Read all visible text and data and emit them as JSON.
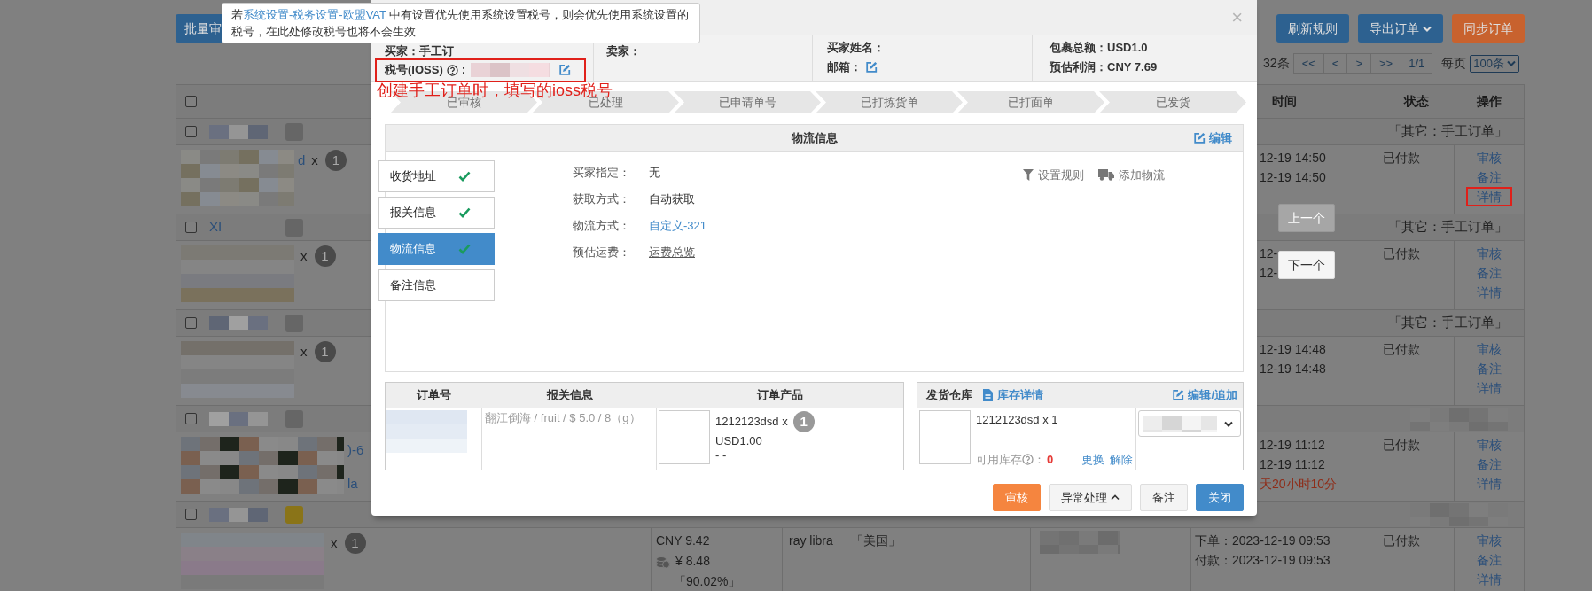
{
  "toolbar": {
    "batch_button": "批量审",
    "buttons": [
      {
        "label": "刷新规则",
        "kind": "primary"
      },
      {
        "label": "导出订单",
        "kind": "dropdown"
      },
      {
        "label": "同步订单",
        "kind": "accent"
      }
    ]
  },
  "pagination": {
    "total": "32条",
    "buttons": [
      "<<",
      "<",
      ">",
      ">>"
    ],
    "page": "1/1",
    "per_page_label": "每页",
    "per_page": "100条"
  },
  "table": {
    "header_checked": false,
    "columns": [
      "时间",
      "状态",
      "操作"
    ],
    "groups": [
      {
        "checked": false,
        "color": "#666666",
        "source": "「其它：手工订单」",
        "product_name": "d",
        "quantity_x": "x",
        "quantity": "1",
        "times_cut": true,
        "times": [
          "12-19 14:50",
          "12-19 14:50"
        ],
        "status": "已付款",
        "actions": [
          {
            "label": "审核",
            "highlighted": false
          },
          {
            "label": "备注",
            "highlighted": false
          },
          {
            "label": "详情",
            "highlighted": true
          }
        ]
      },
      {
        "checked": false,
        "order_link": "XI",
        "color": "#666666",
        "source": "「其它：手工订单」",
        "quantity_x": "x",
        "quantity": "1",
        "times_cut": true,
        "times": [
          "12-",
          "12-"
        ],
        "status": "已付款",
        "actions": [
          {
            "label": "审核",
            "highlighted": false
          },
          {
            "label": "备注",
            "highlighted": false
          },
          {
            "label": "详情",
            "highlighted": false
          }
        ]
      },
      {
        "checked": false,
        "color": "#666666",
        "source": "「其它：手工订单」",
        "quantity_x": "x",
        "quantity": "1",
        "times_cut": true,
        "times": [
          "12-19 14:48",
          "12-19 14:48"
        ],
        "status": "已付款",
        "actions": [
          {
            "label": "审核",
            "highlighted": false
          },
          {
            "label": "备注",
            "highlighted": false
          },
          {
            "label": "详情",
            "highlighted": false
          }
        ]
      },
      {
        "checked": false,
        "color": "#666666",
        "product_lines": [
          ")-6",
          "la"
        ],
        "times_cut": true,
        "times": [
          "12-19 11:12",
          "12-19 11:12"
        ],
        "countdown": "天20小时10分",
        "status": "已付款",
        "actions": [
          {
            "label": "审核",
            "highlighted": false
          },
          {
            "label": "备注",
            "highlighted": false
          },
          {
            "label": "详情",
            "highlighted": false
          }
        ]
      },
      {
        "checked": false,
        "color": "#8a7418",
        "quantity_x": "x",
        "quantity": "1",
        "price": "CNY 9.42",
        "cost": "¥ 8.48",
        "margin": "「90.02%」",
        "buyer": "ray libra",
        "country": "「美国」",
        "times_cut": false,
        "times": [
          "下单：2023-12-19 09:53",
          "付款：2023-12-19 09:53"
        ],
        "status": "已付款",
        "actions": [
          {
            "label": "审核",
            "highlighted": false
          },
          {
            "label": "备注",
            "highlighted": false
          },
          {
            "label": "详情",
            "highlighted": false
          }
        ]
      }
    ]
  },
  "modal": {
    "close": "×",
    "summary": {
      "buyer": "买家：手工订",
      "seller": "卖家：",
      "tax_label": "税号(IOSS)",
      "tax_colon": ":",
      "buyer_name": "买家姓名：",
      "email": "邮箱：",
      "total": "包裹总额：USD1.0",
      "profit": "预估利润：CNY 7.69"
    },
    "steps": [
      "已审核",
      "已处理",
      "已申请单号",
      "已打拣货单",
      "已打面单",
      "已发货"
    ],
    "logistics": {
      "title": "物流信息",
      "edit": "编辑",
      "tabs": [
        {
          "label": "收货地址",
          "done": true,
          "selected": false
        },
        {
          "label": "报关信息",
          "done": true,
          "selected": false
        },
        {
          "label": "物流信息",
          "done": true,
          "selected": true
        },
        {
          "label": "备注信息",
          "done": false,
          "selected": false
        }
      ],
      "fields": [
        {
          "label": "买家指定：",
          "value": "无",
          "kind": "text"
        },
        {
          "label": "获取方式：",
          "value": "自动获取",
          "kind": "text"
        },
        {
          "label": "物流方式：",
          "value": "自定义-321",
          "kind": "link"
        },
        {
          "label": "预估运费：",
          "value": "运费总览",
          "kind": "underline"
        }
      ],
      "actions": [
        {
          "label": "设置规则",
          "kind": "filter"
        },
        {
          "label": "添加物流",
          "kind": "truck"
        }
      ]
    },
    "order_table": {
      "columns": [
        "订单号",
        "报关信息",
        "订单产品"
      ],
      "customs": "翻江倒海 / fruit / $ 5.0 / 8（g）",
      "product_name": "1212123dsd x",
      "quantity": "1",
      "price": "USD1.00",
      "note": "- -"
    },
    "warehouse": {
      "title": "发货仓库",
      "stock_link": "库存详情",
      "edit": "编辑/追加",
      "product": "1212123dsd x 1",
      "stock_label": "可用库存",
      "stock_colon": "：",
      "stock": "0",
      "actions": [
        "更换",
        "解除"
      ]
    },
    "buttons": [
      {
        "label": "审核",
        "kind": "orange"
      },
      {
        "label": "异常处理",
        "kind": "dropdown"
      },
      {
        "label": "备注",
        "kind": "default"
      },
      {
        "label": "关闭",
        "kind": "primary"
      }
    ]
  },
  "tooltip": {
    "before": "若",
    "link": "系统设置-税务设置-欧盟VAT",
    "after": " 中有设置优先使用系统设置税号，则会优先使用系统设置的税号，在此处修改税号也将不会生效"
  },
  "annotation": "创建手工订单时，填写的ioss税号",
  "nav_buttons": [
    {
      "label": "上一个",
      "disabled": true
    },
    {
      "label": "下一个",
      "disabled": false
    }
  ]
}
